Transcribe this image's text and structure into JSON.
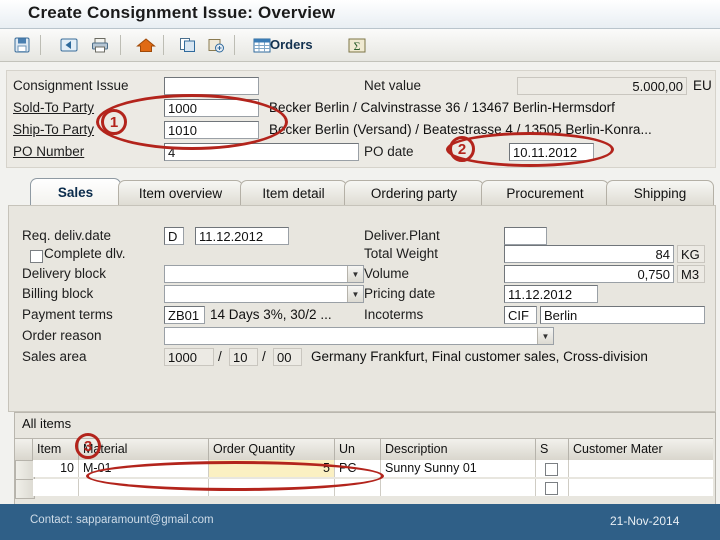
{
  "window": {
    "title": "Create Consignment Issue: Overview"
  },
  "toolbar": {
    "icons": [
      "save-icon",
      "back-icon",
      "print-icon",
      "home-icon",
      "copy-icon",
      "paste-icon",
      "orders-icon",
      "sigma-icon"
    ],
    "orders_label": "Orders"
  },
  "header": {
    "consignment_issue_label": "Consignment Issue",
    "consignment_issue_value": "",
    "net_value_label": "Net value",
    "net_value": "5.000,00",
    "currency": "EU",
    "sold_to_party_label": "Sold-To Party",
    "sold_to_party_value": "1000",
    "sold_to_party_desc": "Becker Berlin / Calvinstrasse 36 / 13467 Berlin-Hermsdorf",
    "ship_to_party_label": "Ship-To Party",
    "ship_to_party_value": "1010",
    "ship_to_party_desc": "Becker Berlin (Versand) / Beatestrasse 4 / 13505 Berlin-Konra...",
    "po_number_label": "PO Number",
    "po_number_value": "4",
    "po_date_label": "PO date",
    "po_date_value": "10.11.2012"
  },
  "tabs": [
    {
      "label": "Sales",
      "selected": true
    },
    {
      "label": "Item overview",
      "selected": false
    },
    {
      "label": "Item detail",
      "selected": false
    },
    {
      "label": "Ordering party",
      "selected": false
    },
    {
      "label": "Procurement",
      "selected": false
    },
    {
      "label": "Shipping",
      "selected": false
    }
  ],
  "sales_tab": {
    "req_deliv_date_label": "Req. deliv.date",
    "req_deliv_date_type": "D",
    "req_deliv_date_value": "11.12.2012",
    "deliver_plant_label": "Deliver.Plant",
    "deliver_plant_value": "",
    "complete_dlv_label": "Complete dlv.",
    "complete_dlv_checked": false,
    "total_weight_label": "Total Weight",
    "total_weight_value": "84",
    "total_weight_unit": "KG",
    "delivery_block_label": "Delivery block",
    "delivery_block_value": "",
    "volume_label": "Volume",
    "volume_value": "0,750",
    "volume_unit": "M3",
    "billing_block_label": "Billing block",
    "billing_block_value": "",
    "pricing_date_label": "Pricing date",
    "pricing_date_value": "11.12.2012",
    "payment_terms_label": "Payment terms",
    "payment_terms_code": "ZB01",
    "payment_terms_text": "14 Days 3%, 30/2 ...",
    "incoterms_label": "Incoterms",
    "incoterms_code": "CIF",
    "incoterms_text": "Berlin",
    "order_reason_label": "Order reason",
    "order_reason_value": "",
    "sales_area_label": "Sales area",
    "sales_area_1": "1000",
    "sales_area_2": "10",
    "sales_area_3": "00",
    "sales_area_text": "Germany Frankfurt, Final customer sales, Cross-division"
  },
  "items": {
    "all_items_label": "All items",
    "columns": [
      "Item",
      "Material",
      "Order Quantity",
      "Un",
      "Description",
      "S",
      "Customer Mater"
    ],
    "rows": [
      {
        "item": "10",
        "material": "M-01",
        "order_quantity": "5",
        "un": "PC",
        "description": "Sunny Sunny 01",
        "s": "",
        "customer_material": ""
      },
      {
        "item": "",
        "material": "",
        "order_quantity": "",
        "un": "",
        "description": "",
        "s": "",
        "customer_material": ""
      }
    ]
  },
  "annotations": [
    {
      "number": "1"
    },
    {
      "number": "2"
    },
    {
      "number": "3"
    }
  ],
  "footer": {
    "contact": "Contact: sapparamount@gmail.com",
    "date": "21-Nov-2014"
  },
  "colors": {
    "annotation": "#b3241c",
    "footer_bg": "#2f5f87",
    "highlight_cell": "#fbf0c2"
  }
}
